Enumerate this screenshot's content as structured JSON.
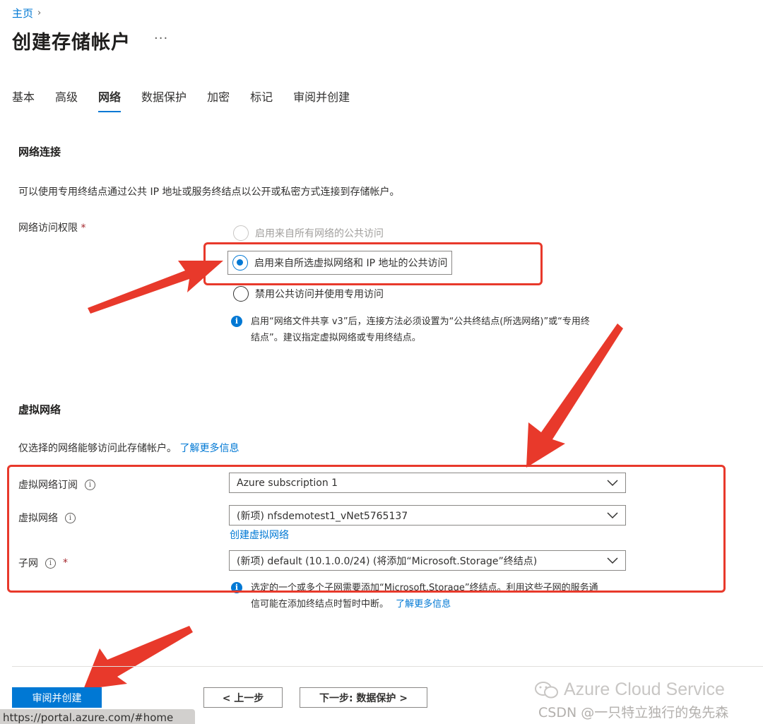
{
  "breadcrumb": {
    "home": "主页",
    "separator": "›"
  },
  "page": {
    "title": "创建存储帐户",
    "more": "···"
  },
  "tabs": [
    {
      "label": "基本",
      "active": false
    },
    {
      "label": "高级",
      "active": false
    },
    {
      "label": "网络",
      "active": true
    },
    {
      "label": "数据保护",
      "active": false
    },
    {
      "label": "加密",
      "active": false
    },
    {
      "label": "标记",
      "active": false
    },
    {
      "label": "审阅并创建",
      "active": false
    }
  ],
  "network": {
    "heading": "网络连接",
    "description": "可以使用专用终结点通过公共 IP 地址或服务终结点以公开或私密方式连接到存储帐户。",
    "access_label": "网络访问权限",
    "required_mark": "*",
    "options": [
      {
        "label": "启用来自所有网络的公共访问",
        "state": "disabled"
      },
      {
        "label": "启用来自所选虚拟网络和 IP 地址的公共访问",
        "state": "checked"
      },
      {
        "label": "禁用公共访问并使用专用访问",
        "state": "unchecked"
      }
    ],
    "info_line1": "启用“网络文件共享 v3”后，连接方法必须设置为“公共终结点(所选网络)”或“专用终",
    "info_line2": "结点”。建议指定虚拟网络或专用终结点。"
  },
  "vnet": {
    "heading": "虚拟网络",
    "description": "仅选择的网络能够访问此存储帐户。",
    "learn_more": "了解更多信息",
    "subscription_label": "虚拟网络订阅",
    "subscription_value": "Azure subscription 1",
    "network_label": "虚拟网络",
    "network_value": "(新项) nfsdemotest1_vNet5765137",
    "create_vnet_link": "创建虚拟网络",
    "subnet_label": "子网",
    "subnet_required": "*",
    "subnet_value": "(新项) default (10.1.0.0/24) (将添加“Microsoft.Storage”终结点)",
    "info_line1": "选定的一个或多个子网需要添加“Microsoft.Storage”终结点。利用这些子网的服务通",
    "info_line2": "信可能在添加终结点时暂时中断。",
    "info_link": "了解更多信息"
  },
  "footer": {
    "review_create": "审阅并创建",
    "previous": "< 上一步",
    "next": "下一步: 数据保护 >"
  },
  "statusbar": {
    "url": "https://portal.azure.com/#home"
  },
  "watermark": {
    "title": "Azure Cloud Service",
    "sub": "CSDN @一只特立独行的兔先森"
  },
  "colors": {
    "accent": "#0078d4",
    "annotation_red": "#e8392b",
    "required": "#a4262c"
  },
  "icons": {
    "breadcrumb_chevron": "chevron-right-icon",
    "info": "info-icon",
    "tooltip": "info-circle-icon",
    "dropdown": "chevron-down-icon",
    "wechat": "wechat-logo-icon"
  }
}
